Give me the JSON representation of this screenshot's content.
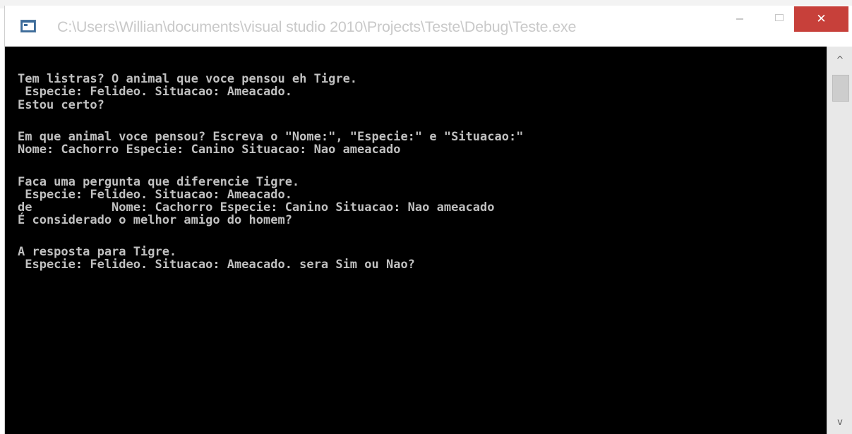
{
  "window": {
    "title": "C:\\Users\\Willian\\documents\\visual studio 2010\\Projects\\Teste\\Debug\\Teste.exe",
    "app_icon": "console-app-icon",
    "controls": {
      "minimize_icon": "minimize-icon",
      "maximize_icon": "maximize-icon",
      "close_glyph": "✕"
    },
    "close_color": "#c7403a"
  },
  "console": {
    "background": "#000000",
    "text_color": "#c0c0c0",
    "lines": [
      "Tem listras? O animal que voce pensou eh Tigre.",
      " Especie: Felideo. Situacao: Ameacado.",
      "Estou certo?",
      "",
      "Em que animal voce pensou? Escreva o \"Nome:\", \"Especie:\" e \"Situacao:\"",
      "Nome: Cachorro Especie: Canino Situacao: Nao ameacado",
      "",
      "Faca uma pergunta que diferencie Tigre.",
      " Especie: Felideo. Situacao: Ameacado.",
      "de           Nome: Cachorro Especie: Canino Situacao: Nao ameacado",
      "É considerado o melhor amigo do homem?",
      "",
      "A resposta para Tigre.",
      " Especie: Felideo. Situacao: Ameacado. sera Sim ou Nao?"
    ]
  },
  "scrollbar": {
    "up_glyph": "^",
    "down_glyph": "v"
  }
}
